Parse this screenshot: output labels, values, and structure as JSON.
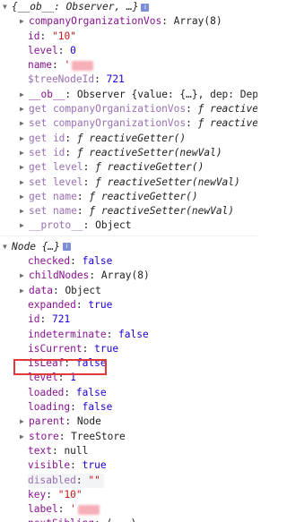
{
  "observer": {
    "header": "{__ob__: Observer, …}",
    "lines": [
      {
        "key": "companyOrganizationVos",
        "value": "Array(8)",
        "type": "plain",
        "expandable": true
      },
      {
        "key": "id",
        "value": "\"10\"",
        "type": "str"
      },
      {
        "key": "level",
        "value": "0",
        "type": "num"
      },
      {
        "key": "name",
        "value": "'",
        "type": "str"
      },
      {
        "key": "$treeNodeId",
        "value": "721",
        "type": "num",
        "dim": true
      },
      {
        "key": "__ob__",
        "value": "Observer {value: {…}, dep: Dep,",
        "type": "plain",
        "expandable": true
      },
      {
        "key": "get companyOrganizationVos",
        "value": "ƒ reactiveG",
        "type": "fn",
        "dim": true,
        "expandable": true
      },
      {
        "key": "set companyOrganizationVos",
        "value": "ƒ reactiveS",
        "type": "fn",
        "dim": true,
        "expandable": true
      },
      {
        "key": "get id",
        "value": "ƒ reactiveGetter()",
        "type": "fn",
        "dim": true,
        "expandable": true
      },
      {
        "key": "set id",
        "value": "ƒ reactiveSetter(newVal)",
        "type": "fn",
        "dim": true,
        "expandable": true
      },
      {
        "key": "get level",
        "value": "ƒ reactiveGetter()",
        "type": "fn",
        "dim": true,
        "expandable": true
      },
      {
        "key": "set level",
        "value": "ƒ reactiveSetter(newVal)",
        "type": "fn",
        "dim": true,
        "expandable": true
      },
      {
        "key": "get name",
        "value": "ƒ reactiveGetter()",
        "type": "fn",
        "dim": true,
        "expandable": true
      },
      {
        "key": "set name",
        "value": "ƒ reactiveSetter(newVal)",
        "type": "fn",
        "dim": true,
        "expandable": true
      },
      {
        "key": "__proto__",
        "value": "Object",
        "type": "plain",
        "dim": true,
        "expandable": true
      }
    ]
  },
  "node": {
    "header": "Node {…}",
    "lines": [
      {
        "key": "checked",
        "value": "false",
        "type": "num"
      },
      {
        "key": "childNodes",
        "value": "Array(8)",
        "type": "plain",
        "expandable": true
      },
      {
        "key": "data",
        "value": "Object",
        "type": "plain",
        "expandable": true
      },
      {
        "key": "expanded",
        "value": "true",
        "type": "num"
      },
      {
        "key": "id",
        "value": "721",
        "type": "num"
      },
      {
        "key": "indeterminate",
        "value": "false",
        "type": "num"
      },
      {
        "key": "isCurrent",
        "value": "true",
        "type": "num"
      },
      {
        "key": "isLeaf",
        "value": "false",
        "type": "num"
      },
      {
        "key": "level",
        "value": "1",
        "type": "num",
        "highlighted": true
      },
      {
        "key": "loaded",
        "value": "false",
        "type": "num"
      },
      {
        "key": "loading",
        "value": "false",
        "type": "num"
      },
      {
        "key": "parent",
        "value": "Node",
        "type": "plain",
        "expandable": true
      },
      {
        "key": "store",
        "value": "TreeStore",
        "type": "plain",
        "expandable": true
      },
      {
        "key": "text",
        "value": "null",
        "type": "plain"
      },
      {
        "key": "visible",
        "value": "true",
        "type": "num"
      },
      {
        "key": "disabled",
        "value": "\"\"",
        "type": "str",
        "dim": true,
        "shaded": true
      },
      {
        "key": "key",
        "value": "\"10\"",
        "type": "str"
      },
      {
        "key": "label",
        "value": "'",
        "type": "str"
      },
      {
        "key": "nextSibling",
        "value": "(...)",
        "type": "plain"
      }
    ]
  },
  "icons": {
    "expand": "triangle-right-icon",
    "collapse": "triangle-down-icon",
    "info": "info-icon",
    "info_glyph": "i"
  },
  "colors": {
    "property_key": "#881391",
    "number_bool": "#1c00cf",
    "string": "#c41a16",
    "highlight_border": "#e23a3a",
    "info_icon_bg": "#7b8ed6"
  }
}
